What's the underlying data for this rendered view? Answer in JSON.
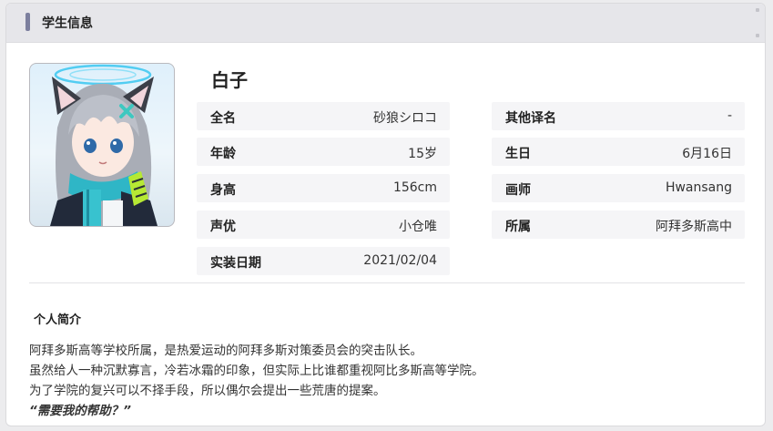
{
  "header": {
    "title": "学生信息"
  },
  "character": {
    "name": "白子",
    "portrait": "student-portrait"
  },
  "info_left": [
    {
      "label": "全名",
      "value": "砂狼シロコ"
    },
    {
      "label": "年龄",
      "value": "15岁"
    },
    {
      "label": "身高",
      "value": "156cm"
    },
    {
      "label": "声优",
      "value": "小仓唯"
    },
    {
      "label": "实装日期",
      "value": "2021/02/04"
    }
  ],
  "info_right": [
    {
      "label": "其他译名",
      "value": "-"
    },
    {
      "label": "生日",
      "value": "6月16日"
    },
    {
      "label": "画师",
      "value": "Hwansang"
    },
    {
      "label": "所属",
      "value": "阿拜多斯高中"
    }
  ],
  "bio": {
    "heading": "个人简介",
    "lines": [
      "阿拜多斯高等学校所属，是热爱运动的阿拜多斯对策委员会的突击队长。",
      "虽然给人一种沉默寡言，冷若冰霜的印象，但实际上比谁都重视阿比多斯高等学院。",
      "为了学院的复兴可以不择手段，所以偶尔会提出一些荒唐的提案。"
    ],
    "quote": "“需要我的帮助？”"
  },
  "colors": {
    "header_bg": "#e6e6ea",
    "accent": "#7c7f9e",
    "row_bg": "#f5f5f7"
  }
}
